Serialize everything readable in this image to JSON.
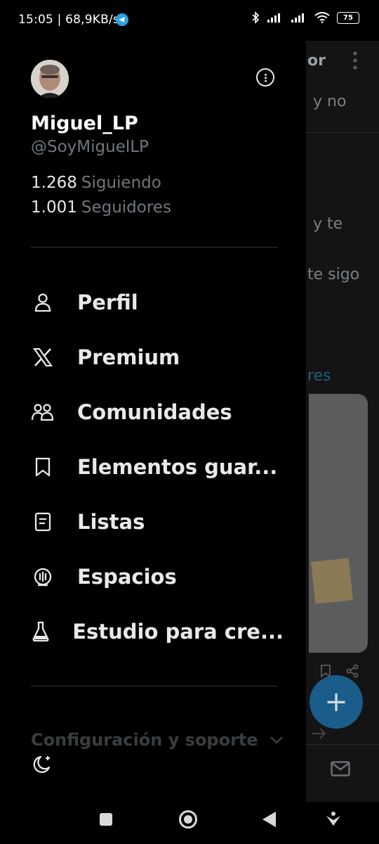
{
  "status_bar": {
    "time_speed": "15:05 | 68,9KB/s",
    "battery": "75"
  },
  "profile": {
    "display_name": "Miguel_LP",
    "handle": "@SoyMiguelLP",
    "following_count": "1.268",
    "following_label": "Siguiendo",
    "followers_count": "1.001",
    "followers_label": "Seguidores"
  },
  "menu": {
    "items": [
      {
        "label": "Perfil",
        "icon": "person-icon"
      },
      {
        "label": "Premium",
        "icon": "x-logo-icon"
      },
      {
        "label": "Comunidades",
        "icon": "communities-icon"
      },
      {
        "label": "Elementos guar...",
        "icon": "bookmark-icon"
      },
      {
        "label": "Listas",
        "icon": "lists-icon"
      },
      {
        "label": "Espacios",
        "icon": "spaces-icon"
      },
      {
        "label": "Estudio para cre...",
        "icon": "flask-icon"
      }
    ]
  },
  "settings": {
    "label": "Configuración y soporte"
  },
  "background": {
    "title_fragment": "or",
    "line1": "y no",
    "line2": "y te",
    "line3": "te sigo",
    "link_fragment": "res"
  },
  "colors": {
    "accent": "#1d9bf0",
    "background": "#000000",
    "text": "#e7e9ea",
    "muted": "#71767b"
  }
}
